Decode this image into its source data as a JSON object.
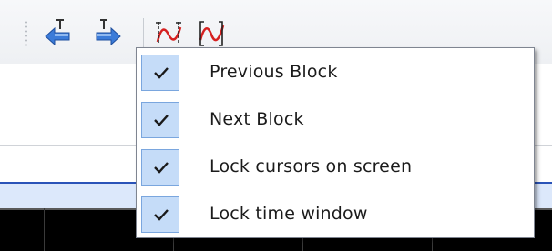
{
  "toolbar": {
    "buttons": [
      {
        "icon": "previous-block-icon"
      },
      {
        "icon": "next-block-icon"
      },
      {
        "icon": "lock-cursors-icon"
      },
      {
        "icon": "lock-time-window-icon"
      }
    ]
  },
  "menu": {
    "items": [
      {
        "label": "Previous Block",
        "checked": true
      },
      {
        "label": "Next Block",
        "checked": true
      },
      {
        "label": "Lock cursors on screen",
        "checked": true
      },
      {
        "label": "Lock time window",
        "checked": true
      }
    ]
  },
  "colors": {
    "accent": "#2a53b8",
    "check_bg": "#c5dcf8",
    "icon_blue": "#3b7bd8",
    "icon_red": "#d62020"
  }
}
